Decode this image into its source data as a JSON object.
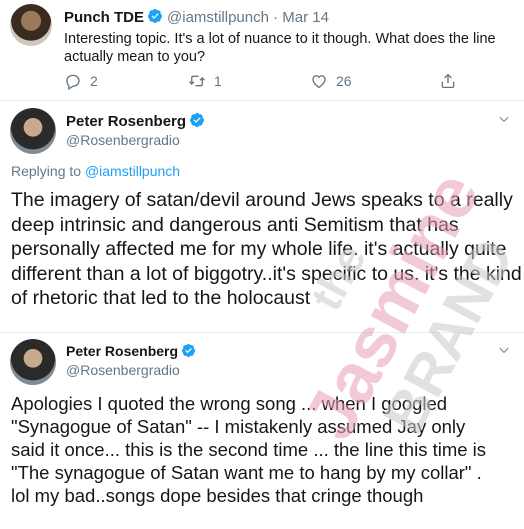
{
  "tweet1": {
    "name": "Punch TDE",
    "handle": "@iamstillpunch",
    "dot": "·",
    "date": "Mar 14",
    "text": "Interesting topic. It's a lot of nuance to it though. What does the line actually mean to you?",
    "replies": "2",
    "retweets": "1",
    "likes": "26"
  },
  "tweet2": {
    "name": "Peter Rosenberg",
    "handle": "@Rosenbergradio",
    "replying_prefix": "Replying to ",
    "replying_to": "@iamstillpunch",
    "text": "The imagery of satan/devil around Jews speaks to a really deep intrinsic and dangerous anti Semitism that has personally affected me for my whole life. it's actually quite different than a lot of biggotry..it's specific to us. it's the kind of rhetoric that led to the holocaust"
  },
  "tweet3": {
    "name": "Peter Rosenberg",
    "handle": "@Rosenbergradio",
    "lines": [
      "Apologies I quoted the wrong song ... when I googled",
      "\"Synagogue of Satan\" -- I mistakenly assumed Jay only",
      "said it once... this is the second time ... the line this time is",
      "\"The synagogue of Satan want me to hang by my collar\" .",
      "lol my bad..songs dope besides that cringe though"
    ]
  },
  "watermark": {
    "line1": "the",
    "line2": "Jasmine",
    "line3": "BRAND",
    "color_primary": "#e7a0b4",
    "color_secondary": "#c9c9c9"
  },
  "colors": {
    "link": "#1da1f2",
    "muted": "#657786",
    "verified": "#1da1f2"
  }
}
